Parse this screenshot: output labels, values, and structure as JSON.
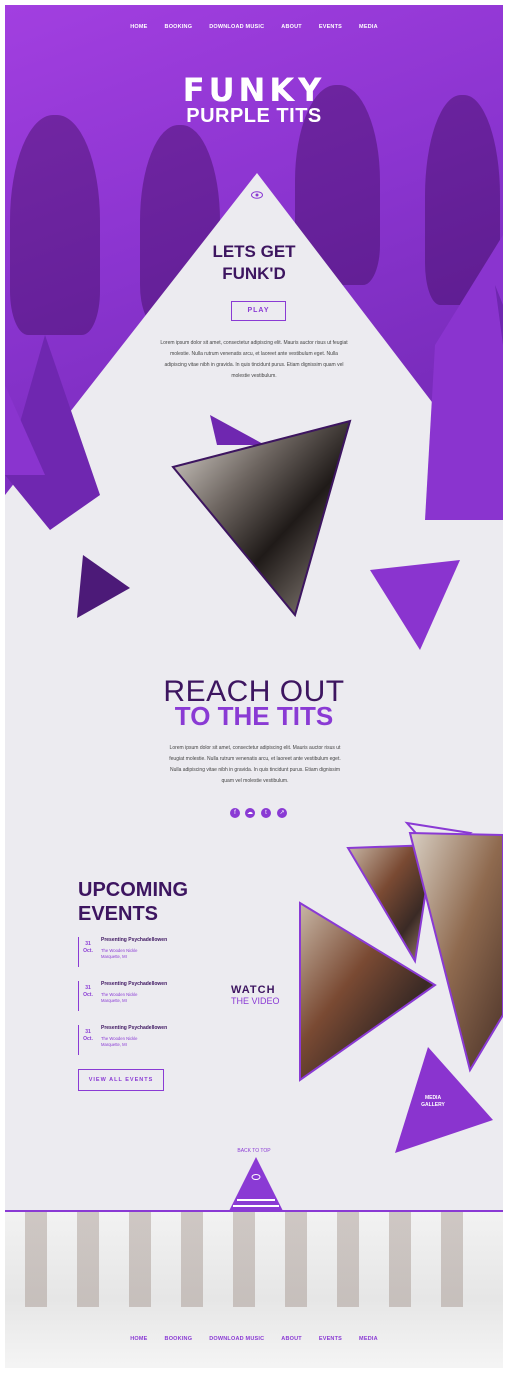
{
  "nav": {
    "items": [
      "HOME",
      "BOOKING",
      "DOWNLOAD MUSIC",
      "ABOUT",
      "EVENTS",
      "MEDIA"
    ]
  },
  "hero": {
    "title_line1": "FUNKY",
    "title_line2": "PURPLE TITS"
  },
  "intro": {
    "heading_line1": "LETS GET",
    "heading_line2": "FUNK'D",
    "play_label": "PLAY",
    "paragraph_lines": [
      "Lorem ipsum dolor sit amet, consectetur adipiscing elit. Mauris auctor risus ut feugiat",
      "molestie. Nulla rutrum venenatis arcu, et laoreet ante vestibulum eget. Nulla",
      "adipiscing vitae nibh in gravida. In quis tincidunt purus. Etiam dignissim quam vel",
      "molestie vestibulum."
    ]
  },
  "reach": {
    "line1": "REACH OUT",
    "line2": "TO THE TITS",
    "paragraph_lines": [
      "Lorem ipsum dolor sit amet, consectetur adipiscing elit. Mauris auctor risus ut",
      "feugiat molestie. Nulla rutrum venenatis arcu, et laoreet ante vestibulum eget.",
      "Nulla adipiscing vitae nibh in gravida. In quis tincidunt purus. Etiam dignissim",
      "quam vel molestie vestibulum."
    ],
    "social_icons": [
      "facebook-icon",
      "soundcloud-icon",
      "twitter-icon",
      "share-icon"
    ]
  },
  "events": {
    "heading_line1": "UPCOMING",
    "heading_line2": "EVENTS",
    "items": [
      {
        "day": "31",
        "month": "Oct.",
        "title": "Presenting Psychadellowen",
        "venue": "The Wooden Nickle",
        "city": "Marquette, MI"
      },
      {
        "day": "31",
        "month": "Oct.",
        "title": "Presenting Psychadellowen",
        "venue": "The Wooden Nickle",
        "city": "Marquette, MI"
      },
      {
        "day": "31",
        "month": "Oct.",
        "title": "Presenting Psychadellowen",
        "venue": "The Wooden Nickle",
        "city": "Marquette, MI"
      }
    ],
    "view_all_label": "VIEW ALL EVENTS"
  },
  "media": {
    "watch_line1": "WATCH",
    "watch_line2": "THE VIDEO",
    "gallery_line1": "MEDIA",
    "gallery_line2": "GALLERY"
  },
  "footer": {
    "back_to_top": "BACK TO TOP",
    "nav_items": [
      "HOME",
      "BOOKING",
      "DOWNLOAD MUSIC",
      "ABOUT",
      "EVENTS",
      "MEDIA"
    ]
  },
  "colors": {
    "primary": "#8a3ad4",
    "dark": "#3d1560",
    "background": "#ecebf0"
  }
}
